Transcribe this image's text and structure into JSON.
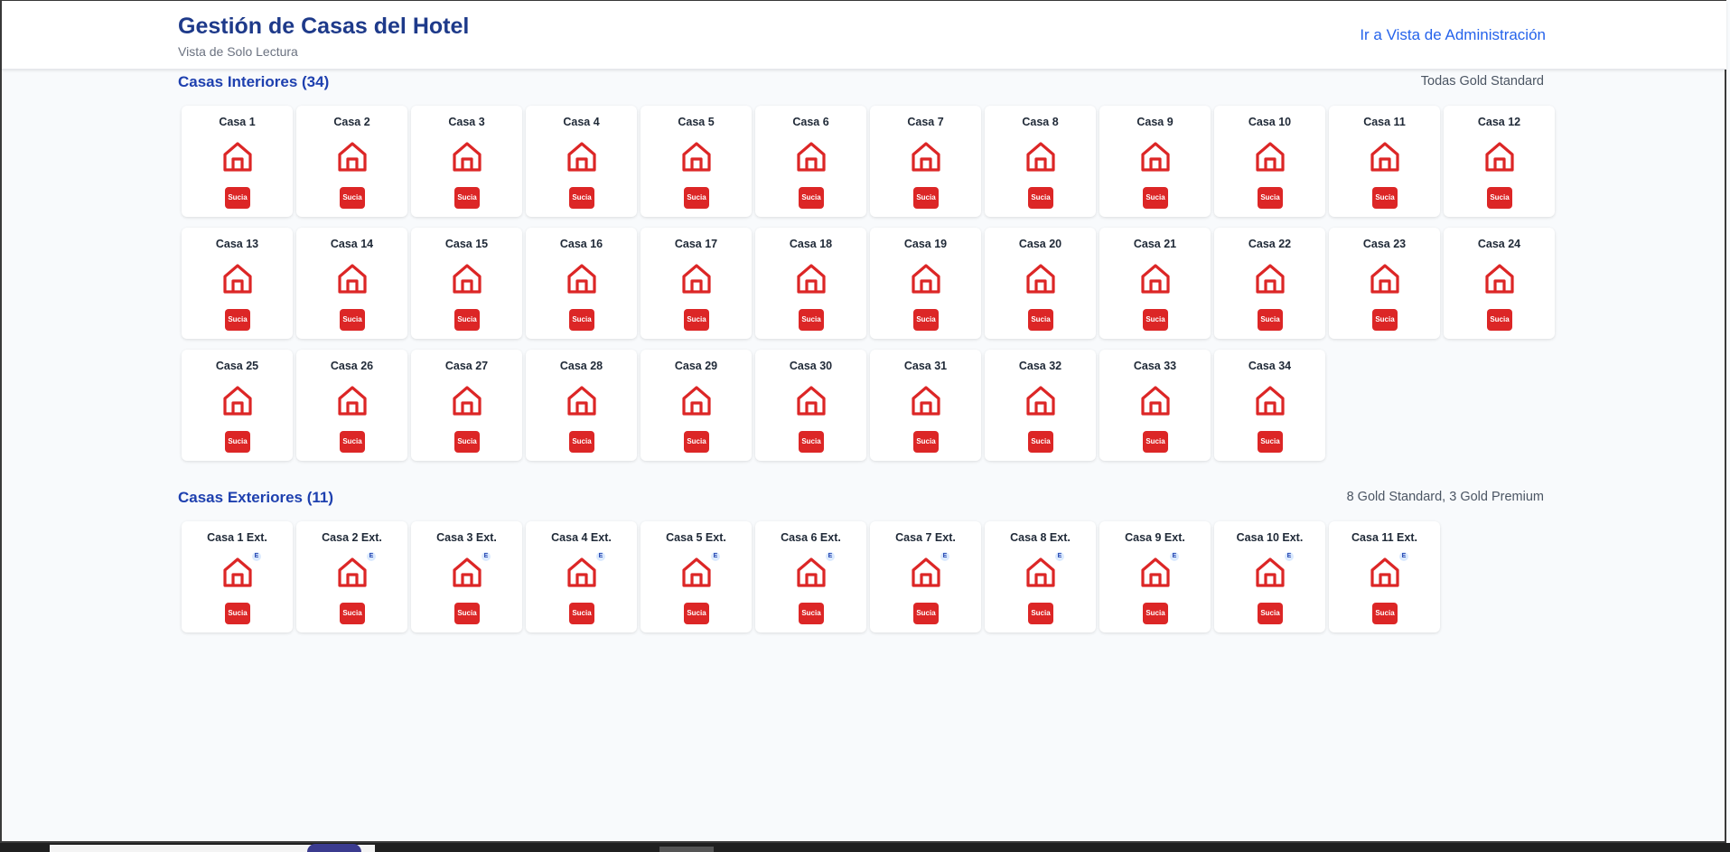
{
  "header": {
    "title": "Gestión de Casas del Hotel",
    "subtitle": "Vista de Solo Lectura",
    "admin_link": "Ir a Vista de Administración"
  },
  "colors": {
    "title": "#1e3a8a",
    "link": "#2563eb",
    "status_dirty": "#dc2626",
    "house_icon": "#dc2626"
  },
  "interior": {
    "title": "Casas Interiores (34)",
    "note": "Todas Gold Standard",
    "houses": [
      {
        "name": "Casa 1",
        "status": "Sucia"
      },
      {
        "name": "Casa 2",
        "status": "Sucia"
      },
      {
        "name": "Casa 3",
        "status": "Sucia"
      },
      {
        "name": "Casa 4",
        "status": "Sucia"
      },
      {
        "name": "Casa 5",
        "status": "Sucia"
      },
      {
        "name": "Casa 6",
        "status": "Sucia"
      },
      {
        "name": "Casa 7",
        "status": "Sucia"
      },
      {
        "name": "Casa 8",
        "status": "Sucia"
      },
      {
        "name": "Casa 9",
        "status": "Sucia"
      },
      {
        "name": "Casa 10",
        "status": "Sucia"
      },
      {
        "name": "Casa 11",
        "status": "Sucia"
      },
      {
        "name": "Casa 12",
        "status": "Sucia"
      },
      {
        "name": "Casa 13",
        "status": "Sucia"
      },
      {
        "name": "Casa 14",
        "status": "Sucia"
      },
      {
        "name": "Casa 15",
        "status": "Sucia"
      },
      {
        "name": "Casa 16",
        "status": "Sucia"
      },
      {
        "name": "Casa 17",
        "status": "Sucia"
      },
      {
        "name": "Casa 18",
        "status": "Sucia"
      },
      {
        "name": "Casa 19",
        "status": "Sucia"
      },
      {
        "name": "Casa 20",
        "status": "Sucia"
      },
      {
        "name": "Casa 21",
        "status": "Sucia"
      },
      {
        "name": "Casa 22",
        "status": "Sucia"
      },
      {
        "name": "Casa 23",
        "status": "Sucia"
      },
      {
        "name": "Casa 24",
        "status": "Sucia"
      },
      {
        "name": "Casa 25",
        "status": "Sucia"
      },
      {
        "name": "Casa 26",
        "status": "Sucia"
      },
      {
        "name": "Casa 27",
        "status": "Sucia"
      },
      {
        "name": "Casa 28",
        "status": "Sucia"
      },
      {
        "name": "Casa 29",
        "status": "Sucia"
      },
      {
        "name": "Casa 30",
        "status": "Sucia"
      },
      {
        "name": "Casa 31",
        "status": "Sucia"
      },
      {
        "name": "Casa 32",
        "status": "Sucia"
      },
      {
        "name": "Casa 33",
        "status": "Sucia"
      },
      {
        "name": "Casa 34",
        "status": "Sucia"
      }
    ]
  },
  "exterior": {
    "title": "Casas Exteriores (11)",
    "note": "8 Gold Standard, 3 Gold Premium",
    "badge": "E",
    "houses": [
      {
        "name": "Casa 1 Ext.",
        "status": "Sucia"
      },
      {
        "name": "Casa 2 Ext.",
        "status": "Sucia"
      },
      {
        "name": "Casa 3 Ext.",
        "status": "Sucia"
      },
      {
        "name": "Casa 4 Ext.",
        "status": "Sucia"
      },
      {
        "name": "Casa 5 Ext.",
        "status": "Sucia"
      },
      {
        "name": "Casa 6 Ext.",
        "status": "Sucia"
      },
      {
        "name": "Casa 7 Ext.",
        "status": "Sucia"
      },
      {
        "name": "Casa 8 Ext.",
        "status": "Sucia"
      },
      {
        "name": "Casa 9 Ext.",
        "status": "Sucia"
      },
      {
        "name": "Casa 10 Ext.",
        "status": "Sucia"
      },
      {
        "name": "Casa 11 Ext.",
        "status": "Sucia"
      }
    ]
  }
}
